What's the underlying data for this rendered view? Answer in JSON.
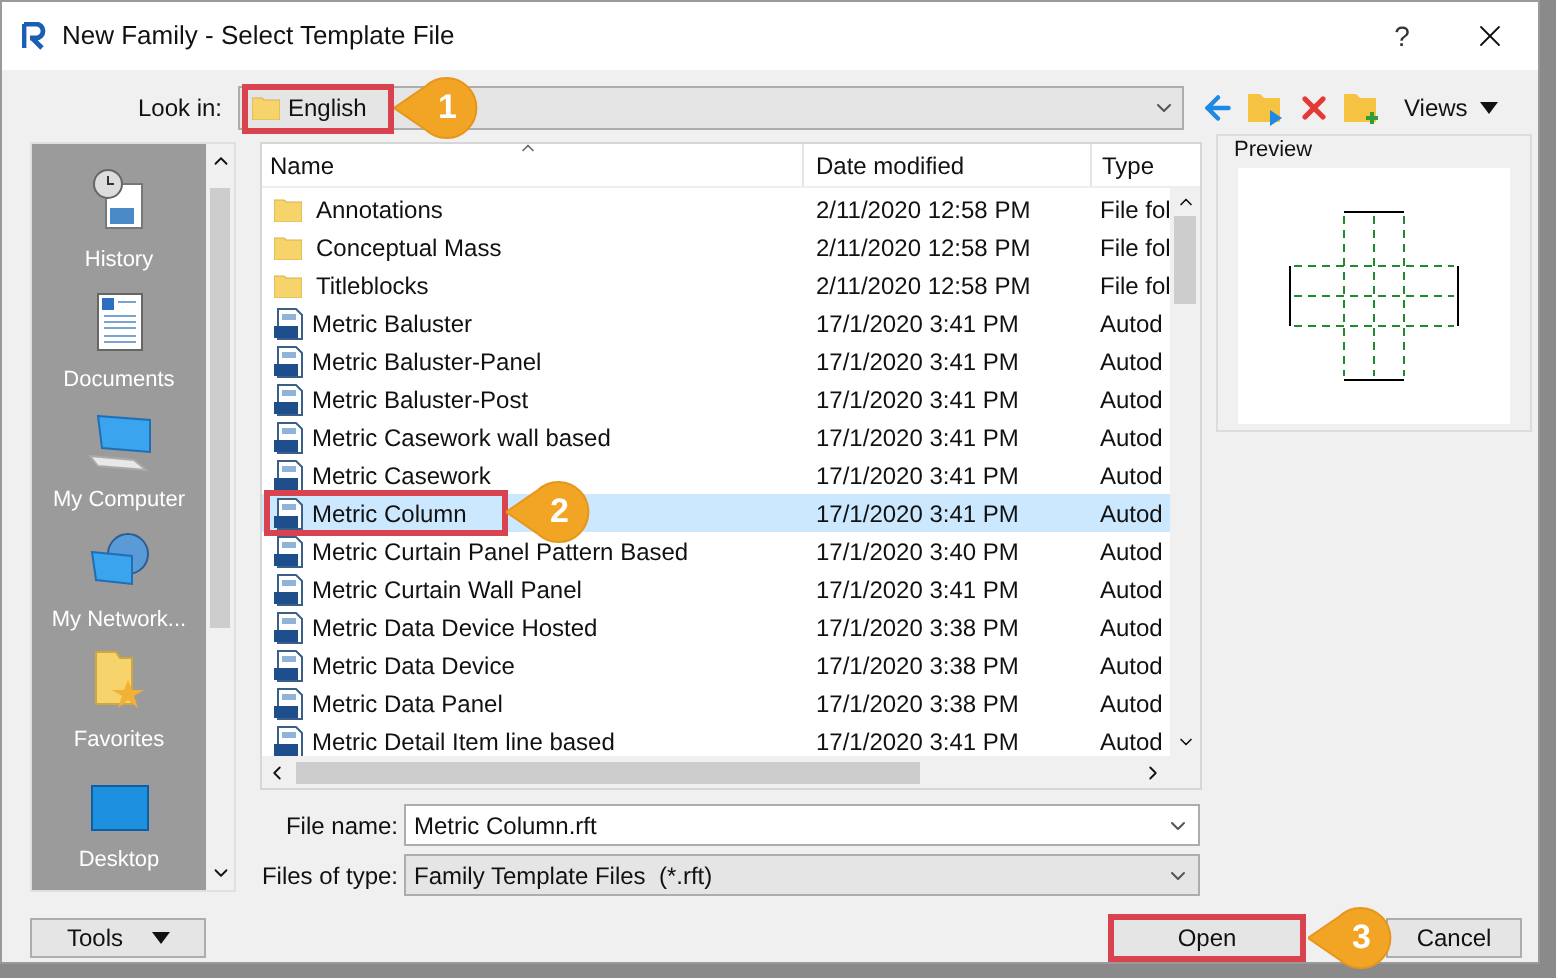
{
  "window": {
    "title": "New Family - Select Template File",
    "help": "?"
  },
  "look_in": {
    "label": "Look in:",
    "value": "English",
    "callout": "1"
  },
  "toolbar": {
    "views": "Views"
  },
  "sidebar": {
    "items": [
      {
        "label": "History",
        "kind": "history"
      },
      {
        "label": "Documents",
        "kind": "documents"
      },
      {
        "label": "My Computer",
        "kind": "computer"
      },
      {
        "label": "My Network...",
        "kind": "network"
      },
      {
        "label": "Favorites",
        "kind": "favorites"
      },
      {
        "label": "Desktop",
        "kind": "desktop"
      }
    ]
  },
  "table": {
    "columns": [
      "Name",
      "Date modified",
      "Type"
    ],
    "rows": [
      {
        "name": "Annotations",
        "date": "2/11/2020 12:58 PM",
        "type": "File fol",
        "kind": "folder",
        "selected": false
      },
      {
        "name": "Conceptual Mass",
        "date": "2/11/2020 12:58 PM",
        "type": "File fol",
        "kind": "folder",
        "selected": false
      },
      {
        "name": "Titleblocks",
        "date": "2/11/2020 12:58 PM",
        "type": "File fol",
        "kind": "folder",
        "selected": false
      },
      {
        "name": "Metric Baluster",
        "date": "17/1/2020 3:41 PM",
        "type": "Autod",
        "kind": "file",
        "selected": false
      },
      {
        "name": "Metric Baluster-Panel",
        "date": "17/1/2020 3:41 PM",
        "type": "Autod",
        "kind": "file",
        "selected": false
      },
      {
        "name": "Metric Baluster-Post",
        "date": "17/1/2020 3:41 PM",
        "type": "Autod",
        "kind": "file",
        "selected": false
      },
      {
        "name": "Metric Casework wall based",
        "date": "17/1/2020 3:41 PM",
        "type": "Autod",
        "kind": "file",
        "selected": false
      },
      {
        "name": "Metric Casework",
        "date": "17/1/2020 3:41 PM",
        "type": "Autod",
        "kind": "file",
        "selected": false
      },
      {
        "name": "Metric Column",
        "date": "17/1/2020 3:41 PM",
        "type": "Autod",
        "kind": "file",
        "selected": true,
        "callout": "2"
      },
      {
        "name": "Metric Curtain Panel Pattern Based",
        "date": "17/1/2020 3:40 PM",
        "type": "Autod",
        "kind": "file",
        "selected": false
      },
      {
        "name": "Metric Curtain Wall Panel",
        "date": "17/1/2020 3:41 PM",
        "type": "Autod",
        "kind": "file",
        "selected": false
      },
      {
        "name": "Metric Data Device Hosted",
        "date": "17/1/2020 3:38 PM",
        "type": "Autod",
        "kind": "file",
        "selected": false
      },
      {
        "name": "Metric Data Device",
        "date": "17/1/2020 3:38 PM",
        "type": "Autod",
        "kind": "file",
        "selected": false
      },
      {
        "name": "Metric Data Panel",
        "date": "17/1/2020 3:38 PM",
        "type": "Autod",
        "kind": "file",
        "selected": false
      },
      {
        "name": "Metric Detail Item line based",
        "date": "17/1/2020 3:41 PM",
        "type": "Autod",
        "kind": "file",
        "selected": false
      }
    ]
  },
  "preview": {
    "label": "Preview"
  },
  "file_name": {
    "label": "File name:",
    "value": "Metric Column.rft"
  },
  "file_type": {
    "label": "Files of type:",
    "value": "Family Template Files  (*.rft)"
  },
  "buttons": {
    "tools": "Tools",
    "open": {
      "label": "Open",
      "callout": "3"
    },
    "cancel": "Cancel"
  }
}
